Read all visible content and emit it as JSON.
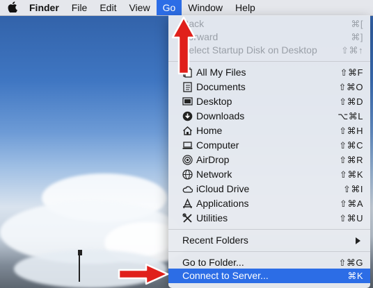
{
  "menubar": {
    "apple": "apple-logo-icon",
    "items": [
      "Finder",
      "File",
      "Edit",
      "View",
      "Go",
      "Window",
      "Help"
    ],
    "active": "Go"
  },
  "go_menu": {
    "items": [
      {
        "label": "Back",
        "shortcut": "⌘[",
        "enabled": false
      },
      {
        "label": "Forward",
        "shortcut": "⌘]",
        "enabled": false
      },
      {
        "label": "Select Startup Disk on Desktop",
        "shortcut": "⇧⌘↑",
        "enabled": false
      },
      {
        "label": "All My Files",
        "shortcut": "⇧⌘F",
        "icon": "all-my-files-icon"
      },
      {
        "label": "Documents",
        "shortcut": "⇧⌘O",
        "icon": "documents-icon"
      },
      {
        "label": "Desktop",
        "shortcut": "⇧⌘D",
        "icon": "desktop-icon"
      },
      {
        "label": "Downloads",
        "shortcut": "⌥⌘L",
        "icon": "downloads-icon"
      },
      {
        "label": "Home",
        "shortcut": "⇧⌘H",
        "icon": "home-icon"
      },
      {
        "label": "Computer",
        "shortcut": "⇧⌘C",
        "icon": "computer-icon"
      },
      {
        "label": "AirDrop",
        "shortcut": "⇧⌘R",
        "icon": "airdrop-icon"
      },
      {
        "label": "Network",
        "shortcut": "⇧⌘K",
        "icon": "network-icon"
      },
      {
        "label": "iCloud Drive",
        "shortcut": "⇧⌘I",
        "icon": "icloud-icon"
      },
      {
        "label": "Applications",
        "shortcut": "⇧⌘A",
        "icon": "applications-icon"
      },
      {
        "label": "Utilities",
        "shortcut": "⇧⌘U",
        "icon": "utilities-icon"
      },
      {
        "label": "Recent Folders",
        "submenu": true
      },
      {
        "label": "Go to Folder...",
        "shortcut": "⇧⌘G"
      },
      {
        "label": "Connect to Server...",
        "shortcut": "⌘K",
        "highlighted": true
      }
    ]
  },
  "colors": {
    "highlight": "#2c6de6",
    "annotation_arrow": "#e0201b"
  }
}
